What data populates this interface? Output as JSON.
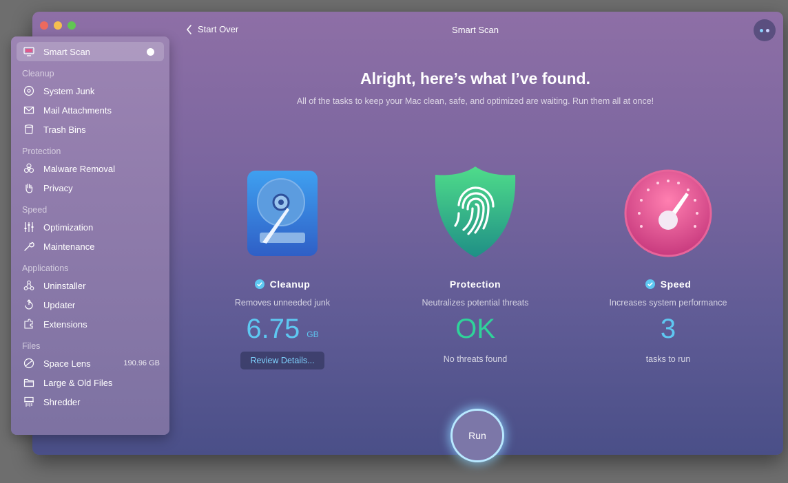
{
  "window": {
    "title": "Smart Scan",
    "back_label": "Start Over"
  },
  "sidebar": {
    "active": {
      "label": "Smart Scan"
    },
    "sections": [
      {
        "title": "Cleanup",
        "items": [
          {
            "label": "System Junk"
          },
          {
            "label": "Mail Attachments"
          },
          {
            "label": "Trash Bins"
          }
        ]
      },
      {
        "title": "Protection",
        "items": [
          {
            "label": "Malware Removal"
          },
          {
            "label": "Privacy"
          }
        ]
      },
      {
        "title": "Speed",
        "items": [
          {
            "label": "Optimization"
          },
          {
            "label": "Maintenance"
          }
        ]
      },
      {
        "title": "Applications",
        "items": [
          {
            "label": "Uninstaller"
          },
          {
            "label": "Updater"
          },
          {
            "label": "Extensions"
          }
        ]
      },
      {
        "title": "Files",
        "items": [
          {
            "label": "Space Lens",
            "meta": "190.96 GB"
          },
          {
            "label": "Large & Old Files"
          },
          {
            "label": "Shredder"
          }
        ]
      }
    ]
  },
  "main": {
    "headline": "Alright, here’s what I’ve found.",
    "subhead": "All of the tasks to keep your Mac clean, safe, and optimized are waiting. Run them all at once!",
    "cleanup": {
      "title": "Cleanup",
      "desc": "Removes unneeded junk",
      "value": "6.75",
      "unit": "GB",
      "button": "Review Details..."
    },
    "protection": {
      "title": "Protection",
      "desc": "Neutralizes potential threats",
      "value": "OK",
      "foot": "No threats found"
    },
    "speed": {
      "title": "Speed",
      "desc": "Increases system performance",
      "value": "3",
      "foot": "tasks to run"
    },
    "run_label": "Run"
  },
  "colors": {
    "accent_blue": "#5ec8f2",
    "ok_green": "#2fd39a",
    "run_ring": "#b8e8ff"
  }
}
